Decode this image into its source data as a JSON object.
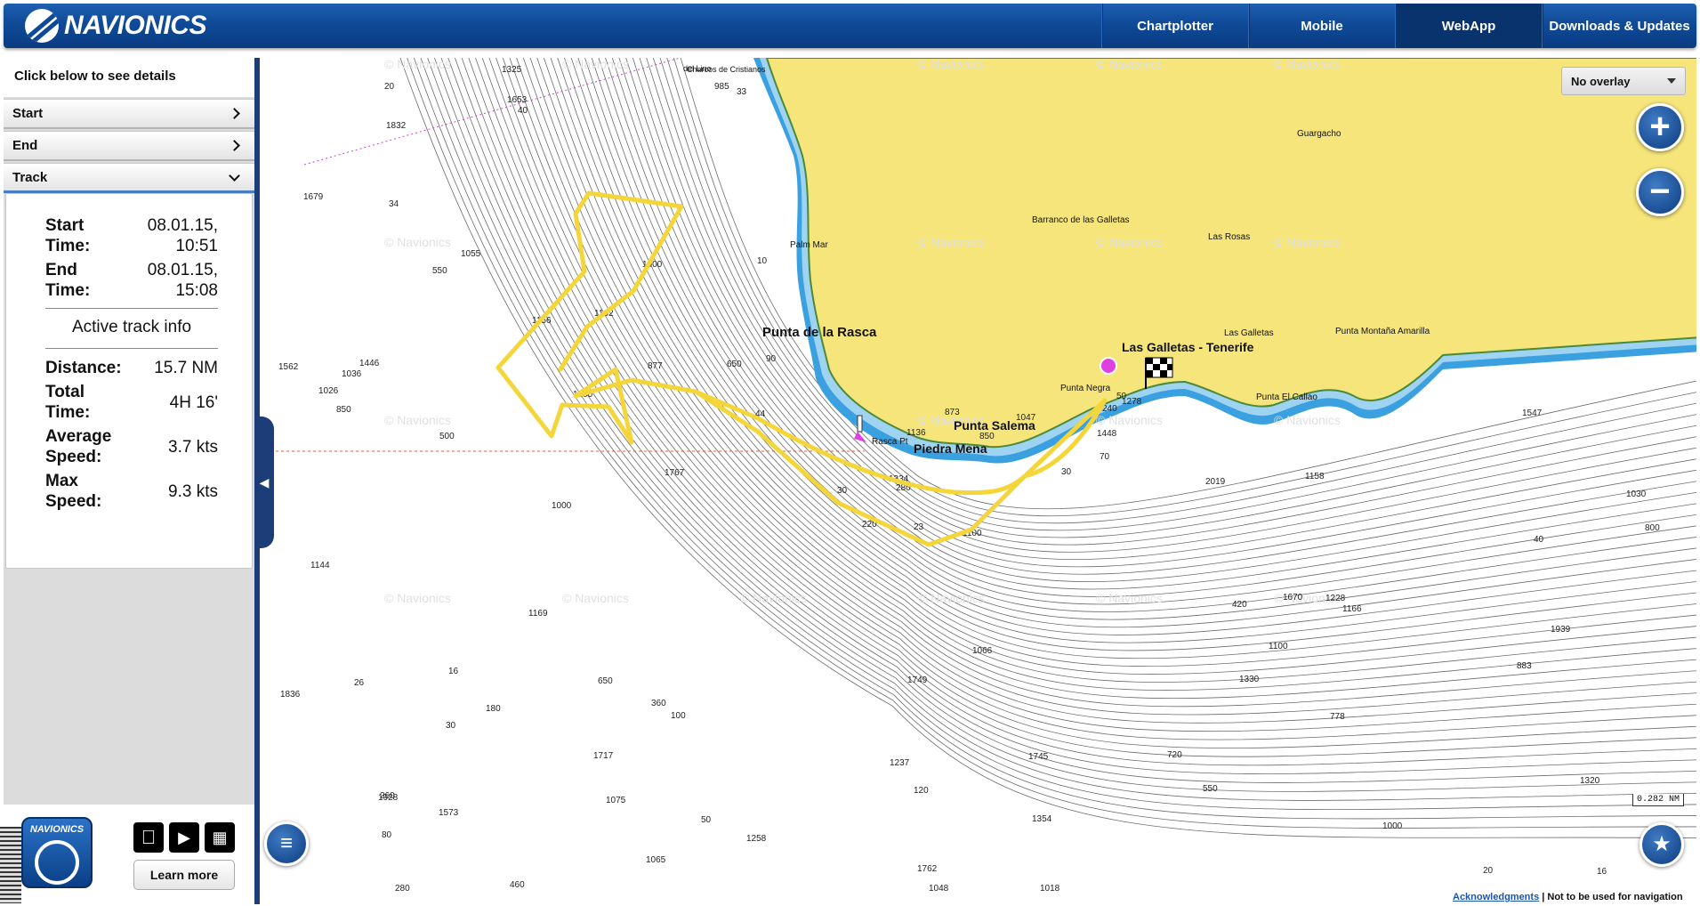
{
  "header": {
    "logo_text": "NAVIONICS",
    "tabs": [
      {
        "label": "Chartplotter"
      },
      {
        "label": "Mobile"
      },
      {
        "label": "WebApp"
      },
      {
        "label": "Downloads & Updates"
      }
    ]
  },
  "panel": {
    "heading": "Click below to see details",
    "accordion": [
      {
        "label": "Start"
      },
      {
        "label": "End"
      },
      {
        "label": "Track"
      }
    ],
    "track": {
      "start_label": "Start Time:",
      "start_value": "08.01.15, 10:51",
      "end_label": "End Time:",
      "end_value": "08.01.15, 15:08",
      "section_title": "Active track info",
      "distance_label": "Distance:",
      "distance_value": "15.7 NM",
      "total_time_label": "Total Time:",
      "total_time_value": "4H 16'",
      "avg_speed_label": "Average Speed:",
      "avg_speed_value": "3.7 kts",
      "max_speed_label": "Max Speed:",
      "max_speed_value": "9.3 kts"
    },
    "footer": {
      "app_logo_text": "NAVIONICS",
      "learn_more": "Learn more"
    }
  },
  "map": {
    "overlay_selected": "No overlay",
    "watermark": "© Navionics",
    "scale_label": "0.282  NM",
    "ack_link": "Acknowledgments",
    "disclaimer": " | Not to be used for navigation",
    "place_names": [
      "Punta de la Rasca",
      "Palm Mar",
      "Barranco de las Galletas",
      "Las Rosas",
      "Guargacho",
      "Las Galletas - Tenerife",
      "Punta Negra",
      "Las Galletas",
      "Punta Montaña Amarilla",
      "Punta El Callao",
      "Rasca Pt",
      "Punta Salema",
      "Piedra Mena",
      "Charcos de Cristianos",
      "del Lino",
      "Puerto"
    ],
    "depth_labels": [
      "1100",
      "550",
      "280",
      "260",
      "240",
      "100",
      "30",
      "40",
      "16",
      "500",
      "220",
      "460",
      "180",
      "90",
      "80",
      "1075",
      "1278",
      "1166",
      "1055",
      "850",
      "420",
      "1334",
      "1237",
      "1136",
      "1000",
      "360",
      "20",
      "1320",
      "1228",
      "650",
      "1200",
      "1330",
      "1065",
      "1562",
      "1448",
      "280",
      "120",
      "70",
      "30",
      "1679",
      "1100",
      "550",
      "1717",
      "1653",
      "20",
      "1745",
      "1767",
      "1446",
      "1162",
      "1325",
      "873",
      "1836",
      "1749",
      "1258",
      "1670",
      "877",
      "1928",
      "1832",
      "1156",
      "1144",
      "1354",
      "1047",
      "1573",
      "2019",
      "1939",
      "1762",
      "1547",
      "1066",
      "1000",
      "1018",
      "720",
      "800",
      "778",
      "850",
      "883",
      "1036",
      "1048",
      "1000",
      "985",
      "1030",
      "1026",
      "1169",
      "650",
      "50",
      "50",
      "44",
      "40",
      "34",
      "30",
      "33",
      "26",
      "23",
      "16",
      "10",
      "1158"
    ]
  },
  "colors": {
    "header_blue": "#0f4a98",
    "land": "#f5e57a",
    "track": "#f5d63a",
    "shallow": "#3aa0e0"
  },
  "icons": [
    "apple-icon",
    "google-play-icon",
    "windows-store-icon",
    "layers-icon",
    "person-icon",
    "plus-icon",
    "minus-icon"
  ]
}
